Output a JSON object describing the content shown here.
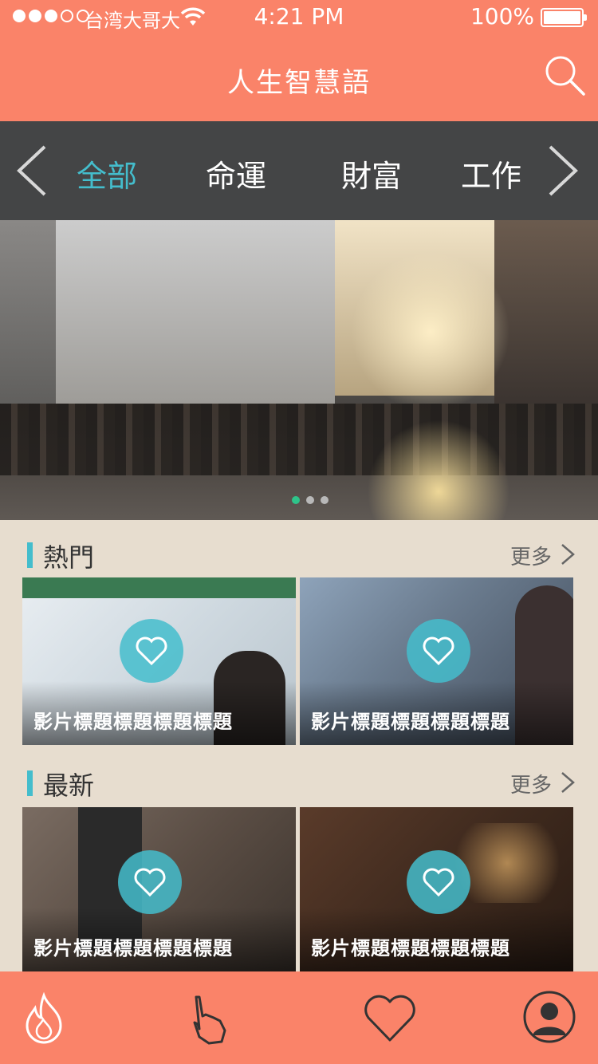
{
  "status": {
    "carrier": "台湾大哥大",
    "time": "4:21 PM",
    "battery": "100%"
  },
  "header": {
    "title": "人生智慧語"
  },
  "categories": [
    {
      "label": "全部",
      "active": true
    },
    {
      "label": "命運",
      "active": false
    },
    {
      "label": "財富",
      "active": false
    },
    {
      "label": "工作",
      "active": false
    }
  ],
  "hot": {
    "label": "熱門",
    "more": "更多",
    "items": [
      {
        "title": "影片標題標題標題標題"
      },
      {
        "title": "影片標題標題標題標題"
      }
    ]
  },
  "latest": {
    "label": "最新",
    "more": "更多",
    "items": [
      {
        "title": "影片標題標題標題標題"
      },
      {
        "title": "影片標題標題標題標題"
      }
    ]
  },
  "colors": {
    "header": "#fa8369",
    "accent": "#44bdcc",
    "catbar": "#444546",
    "bg": "#e7ddcf"
  },
  "icons": [
    "fire-icon",
    "hand-icon",
    "heart-icon",
    "profile-icon",
    "search-icon",
    "chevron-left-icon",
    "chevron-right-icon"
  ]
}
